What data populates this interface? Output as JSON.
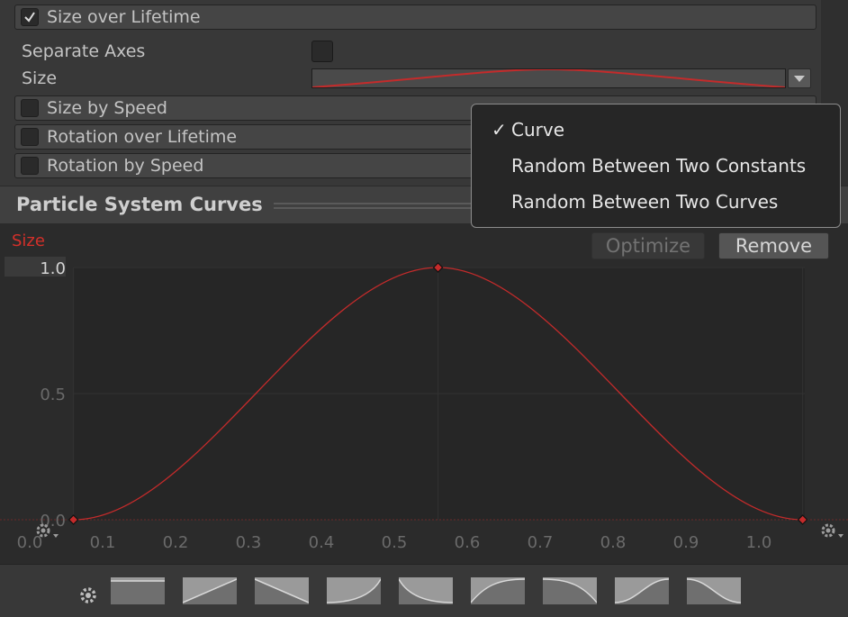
{
  "modules": {
    "size_over_lifetime": {
      "label": "Size over Lifetime",
      "checked": true
    },
    "size_by_speed": {
      "label": "Size by Speed",
      "checked": false
    },
    "rotation_over_lifetime": {
      "label": "Rotation over Lifetime",
      "checked": false
    },
    "rotation_by_speed": {
      "label": "Rotation by Speed",
      "checked": false
    }
  },
  "properties": {
    "separate_axes_label": "Separate Axes",
    "size_label": "Size"
  },
  "curves_panel": {
    "title": "Particle System Curves",
    "curve_name": "Size",
    "optimize_label": "Optimize",
    "remove_label": "Remove"
  },
  "dropdown_menu": {
    "items": [
      {
        "label": "Curve",
        "checked": true
      },
      {
        "label": "Random Between Two Constants",
        "checked": false
      },
      {
        "label": "Random Between Two Curves",
        "checked": false
      }
    ]
  },
  "chart_data": {
    "type": "line",
    "series": [
      {
        "name": "Size",
        "points": [
          [
            0.06,
            0.0
          ],
          [
            0.56,
            1.0
          ],
          [
            1.06,
            0.0
          ]
        ]
      }
    ],
    "x_ticks": [
      "0.0",
      "0.1",
      "0.2",
      "0.3",
      "0.4",
      "0.5",
      "0.6",
      "0.7",
      "0.8",
      "0.9",
      "1.0"
    ],
    "y_ticks": [
      "0.0",
      "0.5",
      "1.0"
    ],
    "xlim": [
      0.0,
      1.0
    ],
    "ylim": [
      0.0,
      1.0
    ],
    "curve_color": "#c42b2b",
    "grid": true
  },
  "presets": {
    "icons": [
      "preset-constant-icon",
      "preset-linear-up-icon",
      "preset-linear-down-icon",
      "preset-ease-in-icon",
      "preset-ease-out-icon",
      "preset-ease-in-out-up-icon",
      "preset-ease-out-down-icon",
      "preset-s-curve-up-icon",
      "preset-s-curve-down-icon"
    ]
  }
}
